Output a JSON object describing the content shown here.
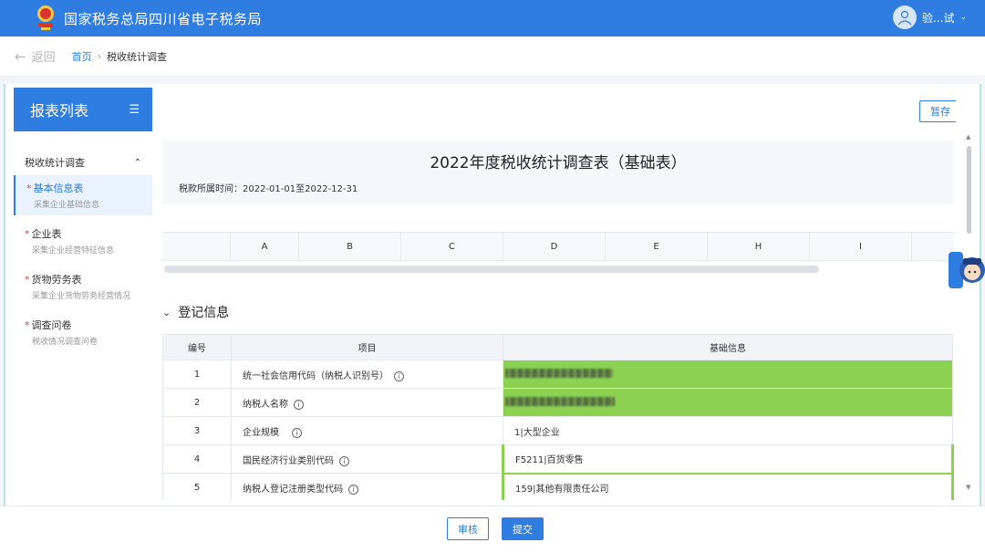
{
  "header": {
    "site_title": "国家税务总局四川省电子税务局",
    "user_name": "验...试",
    "user_menu_icon": "chevron-down-icon",
    "colors": {
      "primary": "#2f7de1"
    }
  },
  "breadcrumb": {
    "back_label": "返回",
    "home_label": "首页",
    "separator": "›",
    "current_label": "税收统计调查"
  },
  "sidebar": {
    "title": "报表列表",
    "group_label": "税收统计调查",
    "items": [
      {
        "title": "基本信息表",
        "subtitle": "采集企业基础信息",
        "required": "*",
        "active": true
      },
      {
        "title": "企业表",
        "subtitle": "采集企业经营特征信息",
        "required": "*",
        "active": false
      },
      {
        "title": "货物劳务表",
        "subtitle": "采集企业货物劳务经营情况",
        "required": "*",
        "active": false
      },
      {
        "title": "调查问卷",
        "subtitle": "税收情况调查问卷",
        "required": "*",
        "active": false
      }
    ]
  },
  "main": {
    "save_label": "暂存",
    "report_title": "2022年度税收统计调查表（基础表）",
    "period_text": "税款所属时间：2022-01-01至2022-12-31",
    "columns": [
      "A",
      "B",
      "C",
      "D",
      "E",
      "H",
      "I"
    ],
    "section_title": "登记信息",
    "table": {
      "headers": [
        "编号",
        "项目",
        "基础信息"
      ],
      "rows": [
        {
          "no": "1",
          "item": "统一社会信用代码（纳税人识别号）",
          "value": "",
          "info": "i"
        },
        {
          "no": "2",
          "item": "纳税人名称",
          "value": "",
          "info": "i"
        },
        {
          "no": "3",
          "item": "企业规模",
          "value": "1|大型企业",
          "info": "i"
        },
        {
          "no": "4",
          "item": "国民经济行业类别代码",
          "value": "F5211|百货零售",
          "info": "i"
        },
        {
          "no": "5",
          "item": "纳税人登记注册类型代码",
          "value": "159|其他有限责任公司",
          "info": "i"
        }
      ]
    }
  },
  "footer": {
    "review_label": "审核",
    "submit_label": "提交"
  }
}
